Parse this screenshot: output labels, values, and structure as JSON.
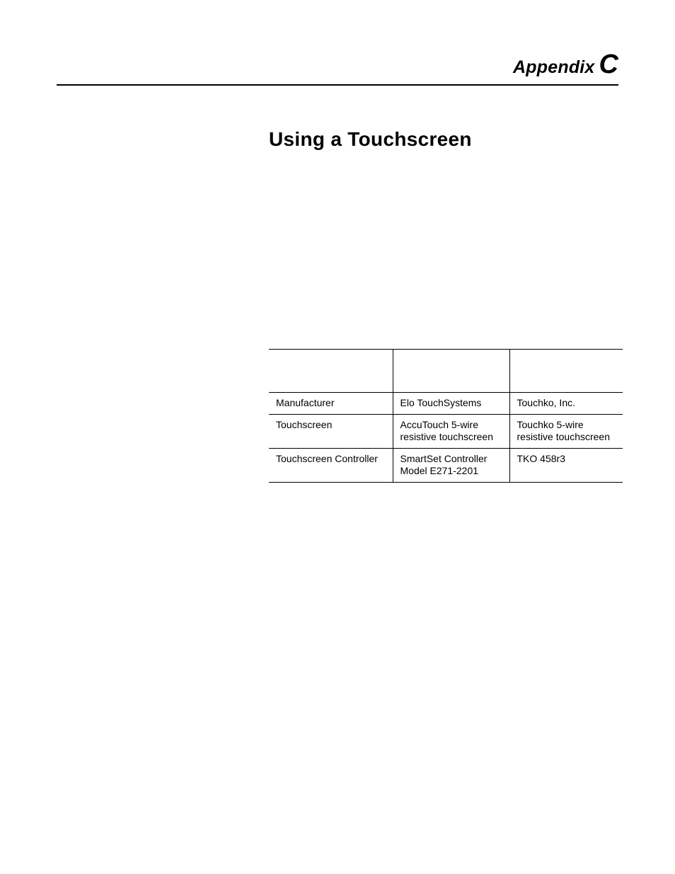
{
  "header": {
    "appendix_word": "Appendix",
    "appendix_letter": "C"
  },
  "title": "Using a Touchscreen",
  "table": {
    "headers": [
      "",
      "",
      ""
    ],
    "rows": [
      {
        "label": "Manufacturer",
        "col2": "Elo TouchSystems",
        "col3": "Touchko, Inc."
      },
      {
        "label": "Touchscreen",
        "col2": "AccuTouch 5-wire resistive touchscreen",
        "col3": "Touchko 5-wire resistive touchscreen"
      },
      {
        "label": "Touchscreen Controller",
        "col2": "SmartSet Controller Model E271-2201",
        "col3": "TKO 458r3"
      }
    ]
  }
}
